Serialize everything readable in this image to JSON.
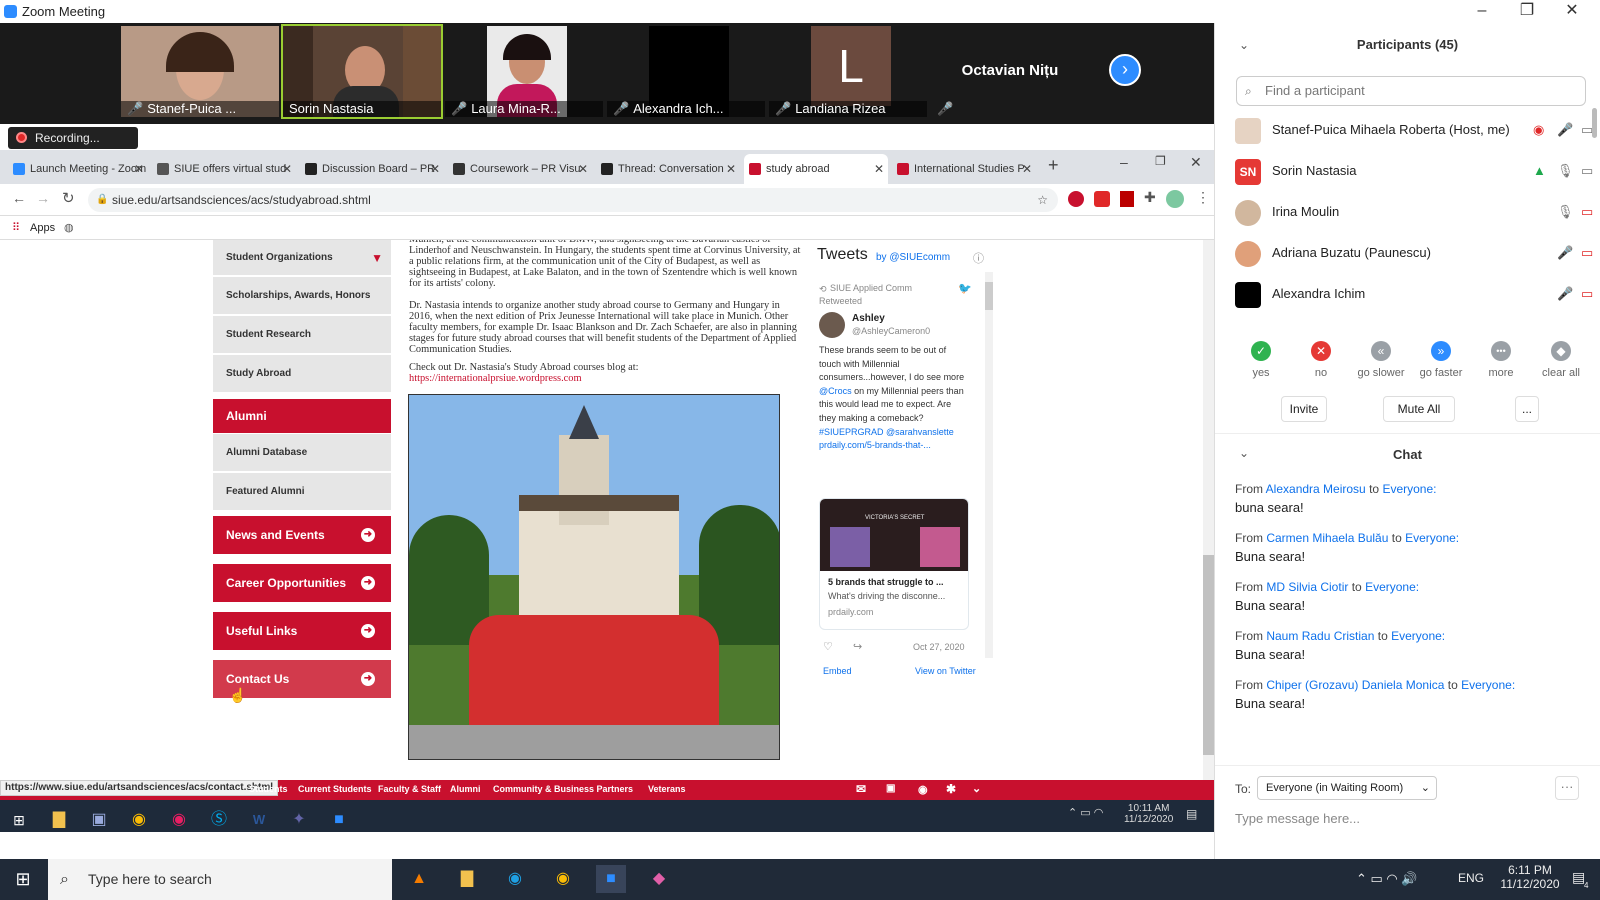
{
  "window": {
    "title": "Zoom Meeting"
  },
  "video_strip": {
    "tiles": [
      {
        "name": "Stanef-Puica ...",
        "muted": true
      },
      {
        "name": "Sorin Nastasia",
        "muted": false
      },
      {
        "name": "Laura Mina-R...",
        "muted": true
      },
      {
        "name": "Alexandra Ich...",
        "muted": true
      },
      {
        "name": "Landiana Rizea",
        "muted": true,
        "initial": "L"
      },
      {
        "name": "Octavian Nițu",
        "muted": true
      }
    ],
    "recording_label": "Recording..."
  },
  "browser": {
    "tabs": [
      {
        "label": "Launch Meeting - Zoom",
        "color": "#2d8cff"
      },
      {
        "label": "SIUE offers virtual stud",
        "color": "#555555"
      },
      {
        "label": "Discussion Board – PR",
        "color": "#222222"
      },
      {
        "label": "Coursework – PR Visu",
        "color": "#333333"
      },
      {
        "label": "Thread: Conversation",
        "color": "#222222"
      },
      {
        "label": "study abroad",
        "color": "#c8102e",
        "active": true
      },
      {
        "label": "International Studies P",
        "color": "#c8102e"
      }
    ],
    "url": "siue.edu/artsandsciences/acs/studyabroad.shtml",
    "bookmarks_label": "Apps",
    "sidebar": {
      "items": [
        {
          "label": "Student Organizations"
        },
        {
          "label": "Scholarships, Awards, Honors"
        },
        {
          "label": "Student Research"
        },
        {
          "label": "Study Abroad"
        }
      ],
      "alumni_header": "Alumni",
      "alumni_items": [
        {
          "label": "Alumni Database"
        },
        {
          "label": "Featured Alumni"
        }
      ],
      "red_items": [
        {
          "label": "News and Events"
        },
        {
          "label": "Career Opportunities"
        },
        {
          "label": "Useful Links"
        },
        {
          "label": "Contact Us"
        }
      ]
    },
    "article": {
      "para1": "Munich, at the communication unit of BMW, and sightseeing at the Bavarian castles of Linderhof and Neuschwanstein. In Hungary, the students spent time at Corvinus University, at a public relations firm, at the communication unit of the City of Budapest, as well as sightseeing in Budapest, at Lake Balaton, and in the town of Szentendre which is well known for its artists' colony.",
      "para2": "Dr. Nastasia intends to organize another study abroad course to Germany and Hungary in 2016, when the next edition of Prix Jeunesse International will take place in Munich. Other faculty members, for example Dr. Isaac Blankson and Dr. Zach Schaefer, are also in planning stages for future study abroad courses that will benefit students of the Department of Applied Communication Studies.",
      "para3": "Check out Dr. Nastasia's Study Abroad courses blog at:",
      "blog_link": "https://internationalprsiue.wordpress.com"
    },
    "tweets": {
      "header": "Tweets",
      "by": "by @SIUEcomm",
      "retweeted_by": "SIUE Applied Comm",
      "retweeted": "Retweeted",
      "author_name": "Ashley",
      "author_handle": "@AshleyCameron0",
      "text_start": "These brands seem to be out of touch with Millennial consumers...however, I do see more ",
      "mention1": "@Crocs",
      "text_mid": " on my Millennial peers than this would lead me to expect. Are they making a comeback? ",
      "hashtag": "#SIUEPRGRAD",
      "mention2": "@sarahvanslette",
      "link": "prdaily.com/5-brands-that-...",
      "card_title": "5 brands that struggle to ...",
      "card_desc": "What's driving the disconne...",
      "card_domain": "prdaily.com",
      "date": "Oct 27, 2020",
      "embed": "Embed",
      "view": "View on Twitter",
      "store_sign": "VICTORIA'S SECRET"
    },
    "footer": {
      "status_url": "https://www.siue.edu/artsandsciences/acs/contact.shtml",
      "links": [
        "Students",
        "Current Students",
        "Faculty & Staff",
        "Alumni",
        "Community & Business Partners",
        "Veterans"
      ]
    },
    "inner_clock": {
      "time": "10:11 AM",
      "date": "11/12/2020"
    }
  },
  "participants": {
    "title": "Participants (45)",
    "search_placeholder": "Find a participant",
    "list": [
      {
        "name": "Stanef-Puica Mihaela Roberta (Host, me)"
      },
      {
        "name": "Sorin Nastasia",
        "initials": "SN"
      },
      {
        "name": "Irina Moulin"
      },
      {
        "name": "Adriana Buzatu (Paunescu)"
      },
      {
        "name": "Alexandra Ichim"
      }
    ],
    "reactions": [
      {
        "label": "yes",
        "color": "#2fb350",
        "glyph": "✓"
      },
      {
        "label": "no",
        "color": "#e53935",
        "glyph": "✕"
      },
      {
        "label": "go slower",
        "color": "#9aa0a6",
        "glyph": "«"
      },
      {
        "label": "go faster",
        "color": "#2d8cff",
        "glyph": "»"
      },
      {
        "label": "more",
        "color": "#9aa0a6",
        "glyph": "•••"
      },
      {
        "label": "clear all",
        "color": "#9aa0a6",
        "glyph": "◆"
      }
    ],
    "invite": "Invite",
    "mute_all": "Mute All",
    "more_btn": "..."
  },
  "chat": {
    "title": "Chat",
    "from": "From",
    "to_word": "to",
    "messages": [
      {
        "sender": "Alexandra Meirosu",
        "to": "Everyone:",
        "text": "buna seara!"
      },
      {
        "sender": "Carmen Mihaela Bulău",
        "to": "Everyone:",
        "text": "Buna seara!"
      },
      {
        "sender": "MD Silvia Ciotir",
        "to": "Everyone:",
        "text": "Buna seara!"
      },
      {
        "sender": "Naum Radu Cristian",
        "to": "Everyone:",
        "text": "Buna  seara!"
      },
      {
        "sender": "Chiper (Grozavu) Daniela Monica",
        "to": "Everyone:",
        "text": "Buna seara!"
      }
    ],
    "to_label": "To:",
    "recipient": "Everyone (in Waiting Room)",
    "input_placeholder": "Type message here..."
  },
  "os_taskbar": {
    "search_placeholder": "Type here to search",
    "lang": "ENG",
    "time": "6:11 PM",
    "date": "11/12/2020",
    "notifications": "4"
  }
}
